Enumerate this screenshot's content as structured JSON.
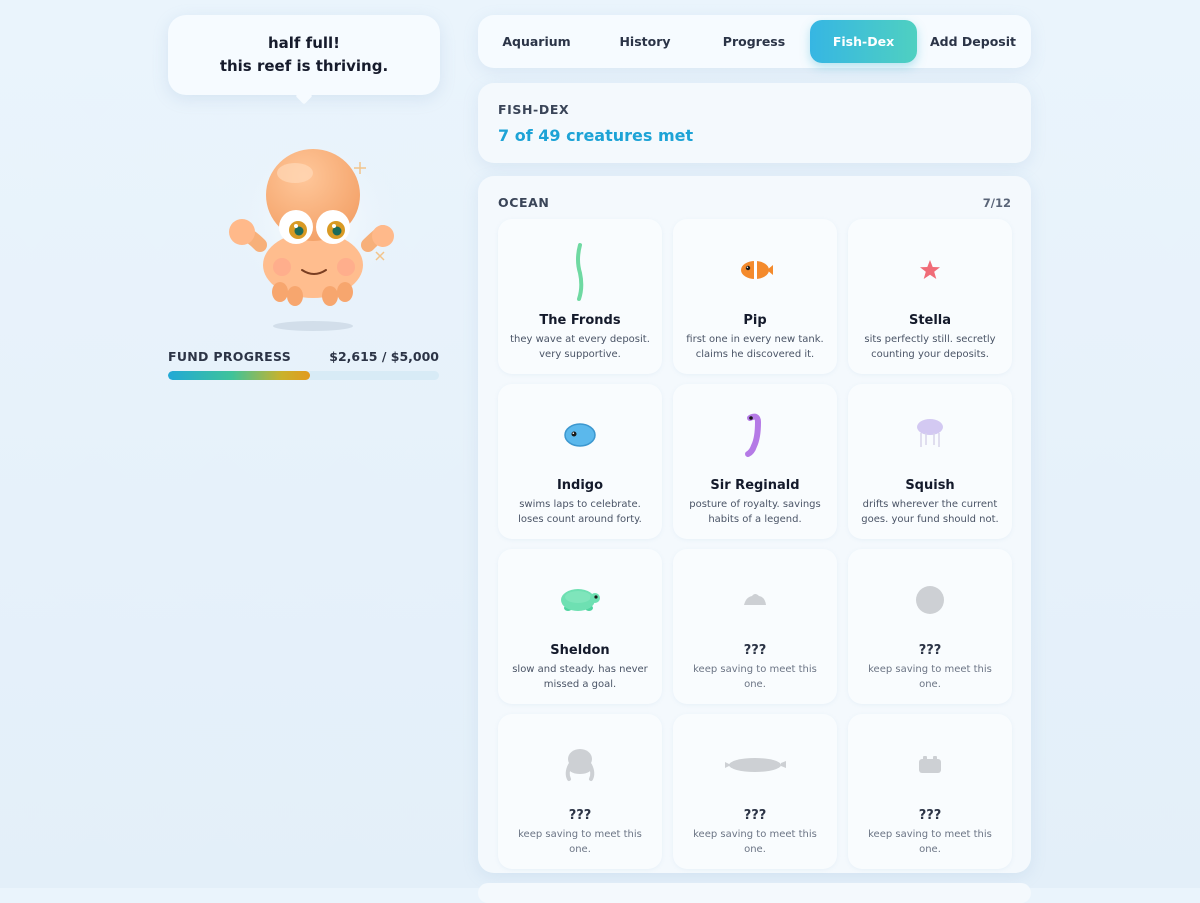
{
  "speech": {
    "line1": "half full!",
    "line2": "this reef is thriving."
  },
  "fund": {
    "label": "FUND PROGRESS",
    "amount": "$2,615 / $5,000",
    "progress": 0.523
  },
  "tabs": [
    {
      "label": "Aquarium"
    },
    {
      "label": "History"
    },
    {
      "label": "Progress"
    },
    {
      "label": "Fish-Dex",
      "active": true
    },
    {
      "label": "Add Deposit"
    }
  ],
  "fishdex": {
    "title": "FISH-DEX",
    "subtitle": "7 of 49 creatures met"
  },
  "ocean": {
    "title": "OCEAN",
    "count": "7/12",
    "creatures": [
      {
        "name": "The Fronds",
        "desc": "they wave at every deposit. very supportive.",
        "icon": "seaweed-icon",
        "locked": false
      },
      {
        "name": "Pip",
        "desc": "first one in every new tank. claims he discovered it.",
        "icon": "clownfish-icon",
        "locked": false
      },
      {
        "name": "Stella",
        "desc": "sits perfectly still. secretly counting your deposits.",
        "icon": "starfish-icon",
        "locked": false
      },
      {
        "name": "Indigo",
        "desc": "swims laps to celebrate. loses count around forty.",
        "icon": "blue-fish-icon",
        "locked": false
      },
      {
        "name": "Sir Reginald",
        "desc": "posture of royalty. savings habits of a legend.",
        "icon": "seahorse-icon",
        "locked": false
      },
      {
        "name": "Squish",
        "desc": "drifts wherever the current goes. your fund should not.",
        "icon": "jellyfish-icon",
        "locked": false
      },
      {
        "name": "Sheldon",
        "desc": "slow and steady. has never missed a goal.",
        "icon": "turtle-icon",
        "locked": false
      },
      {
        "name": "???",
        "desc": "keep saving to meet this one.",
        "icon": "locked-shell-icon",
        "locked": true
      },
      {
        "name": "???",
        "desc": "keep saving to meet this one.",
        "icon": "locked-pufferfish-icon",
        "locked": true
      },
      {
        "name": "???",
        "desc": "keep saving to meet this one.",
        "icon": "locked-octopus-icon",
        "locked": true
      },
      {
        "name": "???",
        "desc": "keep saving to meet this one.",
        "icon": "locked-shark-icon",
        "locked": true
      },
      {
        "name": "???",
        "desc": "keep saving to meet this one.",
        "icon": "locked-crab-icon",
        "locked": true
      }
    ]
  },
  "colors": {
    "accent": "#1da3d6",
    "tab_active_start": "#36b6e3",
    "tab_active_end": "#4fd0c1",
    "locked": "#cfd2d6"
  }
}
